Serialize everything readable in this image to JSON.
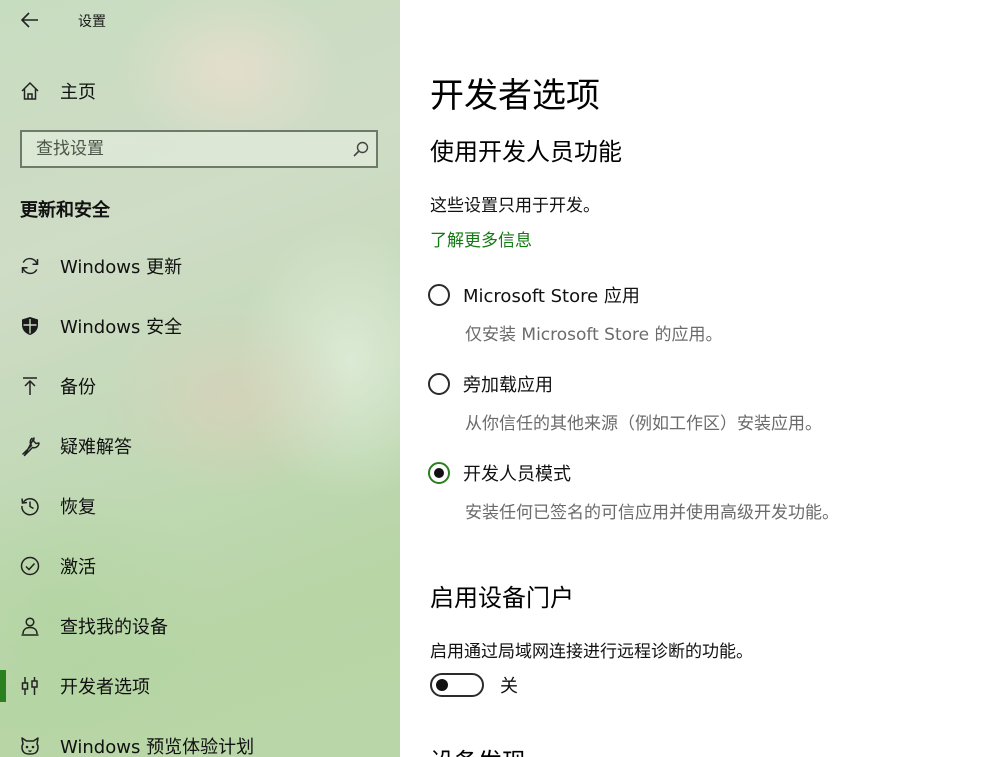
{
  "window": {
    "title": "设置"
  },
  "sidebar": {
    "home_label": "主页",
    "search": {
      "placeholder": "查找设置"
    },
    "section_heading": "更新和安全",
    "items": [
      {
        "label": "Windows 更新",
        "icon": "sync-icon"
      },
      {
        "label": "Windows 安全",
        "icon": "shield-icon"
      },
      {
        "label": "备份",
        "icon": "upload-arrow-icon"
      },
      {
        "label": "疑难解答",
        "icon": "wrench-icon"
      },
      {
        "label": "恢复",
        "icon": "history-icon"
      },
      {
        "label": "激活",
        "icon": "check-circle-icon"
      },
      {
        "label": "查找我的设备",
        "icon": "person-location-icon"
      },
      {
        "label": "开发者选项",
        "icon": "dev-tools-icon",
        "selected": true
      },
      {
        "label": "Windows 预览体验计划",
        "icon": "insider-cat-icon"
      }
    ],
    "accent_color": "#2a7f1e"
  },
  "content": {
    "page_title": "开发者选项",
    "dev_features": {
      "heading": "使用开发人员功能",
      "description": "这些设置只用于开发。",
      "learn_more": "了解更多信息",
      "options": [
        {
          "label": "Microsoft Store 应用",
          "description": "仅安装 Microsoft Store 的应用。",
          "checked": false
        },
        {
          "label": "旁加载应用",
          "description": "从你信任的其他来源（例如工作区）安装应用。",
          "checked": false
        },
        {
          "label": "开发人员模式",
          "description": "安装任何已签名的可信应用并使用高级开发功能。",
          "checked": true
        }
      ]
    },
    "device_portal": {
      "heading": "启用设备门户",
      "description": "启用通过局域网连接进行远程诊断的功能。",
      "toggle_state_label": "关",
      "toggle_on": false
    },
    "next_heading": "设备发现"
  }
}
